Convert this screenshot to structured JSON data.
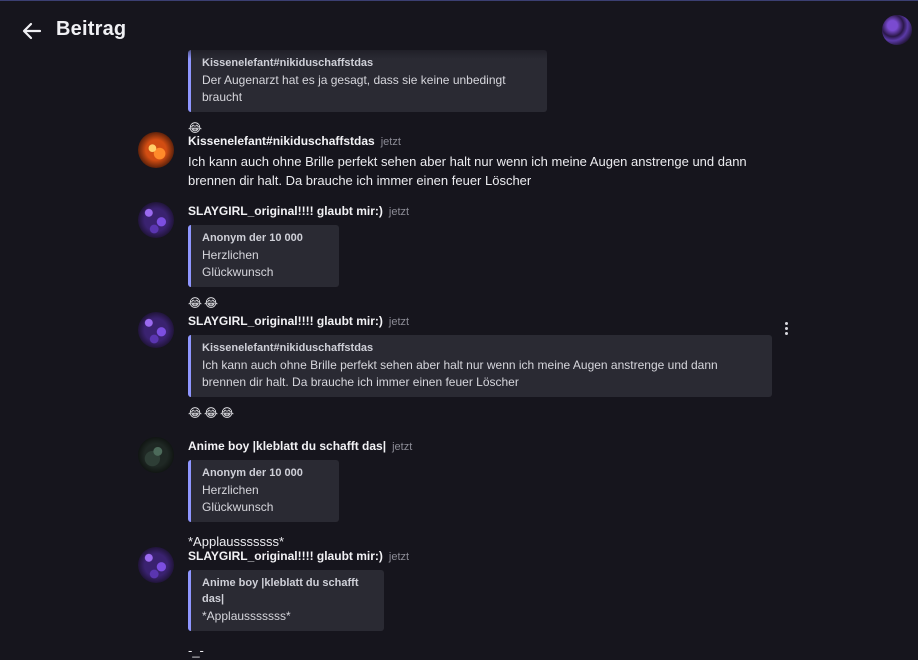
{
  "header": {
    "title": "Beitrag"
  },
  "messages": [
    {
      "id": "m0",
      "quote": {
        "user": "Kissenelefant#nikiduschaffstdas",
        "text": "Der Augenarzt hat es ja gesagt, dass sie keine unbedingt braucht"
      },
      "emoji": "😂"
    },
    {
      "id": "m1",
      "user": "Kissenelefant#nikiduschaffstdas",
      "time": "jetzt",
      "text": "Ich kann auch ohne Brille perfekt sehen aber halt nur wenn ich meine Augen anstrenge und dann brennen dir halt. Da brauche ich immer einen feuer Löscher"
    },
    {
      "id": "m2",
      "user": "SLAYGIRL_original!!!! glaubt mir:)",
      "time": "jetzt",
      "quote": {
        "user": "Anonym der 10 000",
        "text": "Herzlichen Glückwunsch"
      },
      "emoji": "😂😂"
    },
    {
      "id": "m3",
      "user": "SLAYGIRL_original!!!! glaubt mir:)",
      "time": "jetzt",
      "quote": {
        "user": "Kissenelefant#nikiduschaffstdas",
        "text": "Ich kann auch ohne Brille perfekt sehen aber halt nur wenn ich meine Augen anstrenge und dann brennen dir halt. Da brauche ich immer einen feuer Löscher"
      },
      "emoji": "😂😂😂"
    },
    {
      "id": "m4",
      "user": "Anime boy |kleblatt du schafft das|",
      "time": "jetzt",
      "quote": {
        "user": "Anonym der 10 000",
        "text": "Herzlichen Glückwunsch"
      },
      "text": "*Applausssssss*"
    },
    {
      "id": "m5",
      "user": "SLAYGIRL_original!!!! glaubt mir:)",
      "time": "jetzt",
      "quote": {
        "user": "Anime boy |kleblatt du schafft das|",
        "text": "*Applausssssss*"
      },
      "text": "-_-"
    }
  ]
}
